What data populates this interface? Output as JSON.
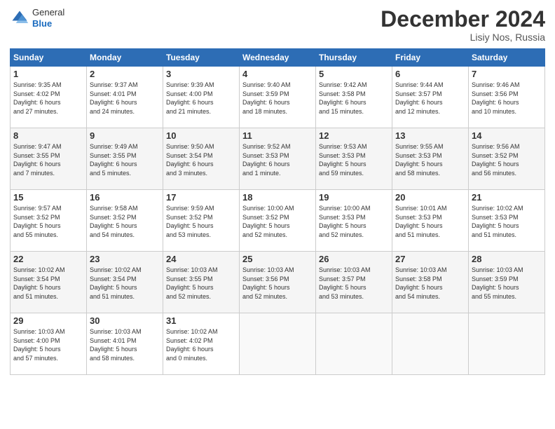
{
  "header": {
    "logo_general": "General",
    "logo_blue": "Blue",
    "month_title": "December 2024",
    "location": "Lisiy Nos, Russia"
  },
  "days_of_week": [
    "Sunday",
    "Monday",
    "Tuesday",
    "Wednesday",
    "Thursday",
    "Friday",
    "Saturday"
  ],
  "weeks": [
    [
      {
        "day": "1",
        "info": "Sunrise: 9:35 AM\nSunset: 4:02 PM\nDaylight: 6 hours\nand 27 minutes."
      },
      {
        "day": "2",
        "info": "Sunrise: 9:37 AM\nSunset: 4:01 PM\nDaylight: 6 hours\nand 24 minutes."
      },
      {
        "day": "3",
        "info": "Sunrise: 9:39 AM\nSunset: 4:00 PM\nDaylight: 6 hours\nand 21 minutes."
      },
      {
        "day": "4",
        "info": "Sunrise: 9:40 AM\nSunset: 3:59 PM\nDaylight: 6 hours\nand 18 minutes."
      },
      {
        "day": "5",
        "info": "Sunrise: 9:42 AM\nSunset: 3:58 PM\nDaylight: 6 hours\nand 15 minutes."
      },
      {
        "day": "6",
        "info": "Sunrise: 9:44 AM\nSunset: 3:57 PM\nDaylight: 6 hours\nand 12 minutes."
      },
      {
        "day": "7",
        "info": "Sunrise: 9:46 AM\nSunset: 3:56 PM\nDaylight: 6 hours\nand 10 minutes."
      }
    ],
    [
      {
        "day": "8",
        "info": "Sunrise: 9:47 AM\nSunset: 3:55 PM\nDaylight: 6 hours\nand 7 minutes."
      },
      {
        "day": "9",
        "info": "Sunrise: 9:49 AM\nSunset: 3:55 PM\nDaylight: 6 hours\nand 5 minutes."
      },
      {
        "day": "10",
        "info": "Sunrise: 9:50 AM\nSunset: 3:54 PM\nDaylight: 6 hours\nand 3 minutes."
      },
      {
        "day": "11",
        "info": "Sunrise: 9:52 AM\nSunset: 3:53 PM\nDaylight: 6 hours\nand 1 minute."
      },
      {
        "day": "12",
        "info": "Sunrise: 9:53 AM\nSunset: 3:53 PM\nDaylight: 5 hours\nand 59 minutes."
      },
      {
        "day": "13",
        "info": "Sunrise: 9:55 AM\nSunset: 3:53 PM\nDaylight: 5 hours\nand 58 minutes."
      },
      {
        "day": "14",
        "info": "Sunrise: 9:56 AM\nSunset: 3:52 PM\nDaylight: 5 hours\nand 56 minutes."
      }
    ],
    [
      {
        "day": "15",
        "info": "Sunrise: 9:57 AM\nSunset: 3:52 PM\nDaylight: 5 hours\nand 55 minutes."
      },
      {
        "day": "16",
        "info": "Sunrise: 9:58 AM\nSunset: 3:52 PM\nDaylight: 5 hours\nand 54 minutes."
      },
      {
        "day": "17",
        "info": "Sunrise: 9:59 AM\nSunset: 3:52 PM\nDaylight: 5 hours\nand 53 minutes."
      },
      {
        "day": "18",
        "info": "Sunrise: 10:00 AM\nSunset: 3:52 PM\nDaylight: 5 hours\nand 52 minutes."
      },
      {
        "day": "19",
        "info": "Sunrise: 10:00 AM\nSunset: 3:53 PM\nDaylight: 5 hours\nand 52 minutes."
      },
      {
        "day": "20",
        "info": "Sunrise: 10:01 AM\nSunset: 3:53 PM\nDaylight: 5 hours\nand 51 minutes."
      },
      {
        "day": "21",
        "info": "Sunrise: 10:02 AM\nSunset: 3:53 PM\nDaylight: 5 hours\nand 51 minutes."
      }
    ],
    [
      {
        "day": "22",
        "info": "Sunrise: 10:02 AM\nSunset: 3:54 PM\nDaylight: 5 hours\nand 51 minutes."
      },
      {
        "day": "23",
        "info": "Sunrise: 10:02 AM\nSunset: 3:54 PM\nDaylight: 5 hours\nand 51 minutes."
      },
      {
        "day": "24",
        "info": "Sunrise: 10:03 AM\nSunset: 3:55 PM\nDaylight: 5 hours\nand 52 minutes."
      },
      {
        "day": "25",
        "info": "Sunrise: 10:03 AM\nSunset: 3:56 PM\nDaylight: 5 hours\nand 52 minutes."
      },
      {
        "day": "26",
        "info": "Sunrise: 10:03 AM\nSunset: 3:57 PM\nDaylight: 5 hours\nand 53 minutes."
      },
      {
        "day": "27",
        "info": "Sunrise: 10:03 AM\nSunset: 3:58 PM\nDaylight: 5 hours\nand 54 minutes."
      },
      {
        "day": "28",
        "info": "Sunrise: 10:03 AM\nSunset: 3:59 PM\nDaylight: 5 hours\nand 55 minutes."
      }
    ],
    [
      {
        "day": "29",
        "info": "Sunrise: 10:03 AM\nSunset: 4:00 PM\nDaylight: 5 hours\nand 57 minutes."
      },
      {
        "day": "30",
        "info": "Sunrise: 10:03 AM\nSunset: 4:01 PM\nDaylight: 5 hours\nand 58 minutes."
      },
      {
        "day": "31",
        "info": "Sunrise: 10:02 AM\nSunset: 4:02 PM\nDaylight: 6 hours\nand 0 minutes."
      },
      {
        "day": "",
        "info": ""
      },
      {
        "day": "",
        "info": ""
      },
      {
        "day": "",
        "info": ""
      },
      {
        "day": "",
        "info": ""
      }
    ]
  ]
}
